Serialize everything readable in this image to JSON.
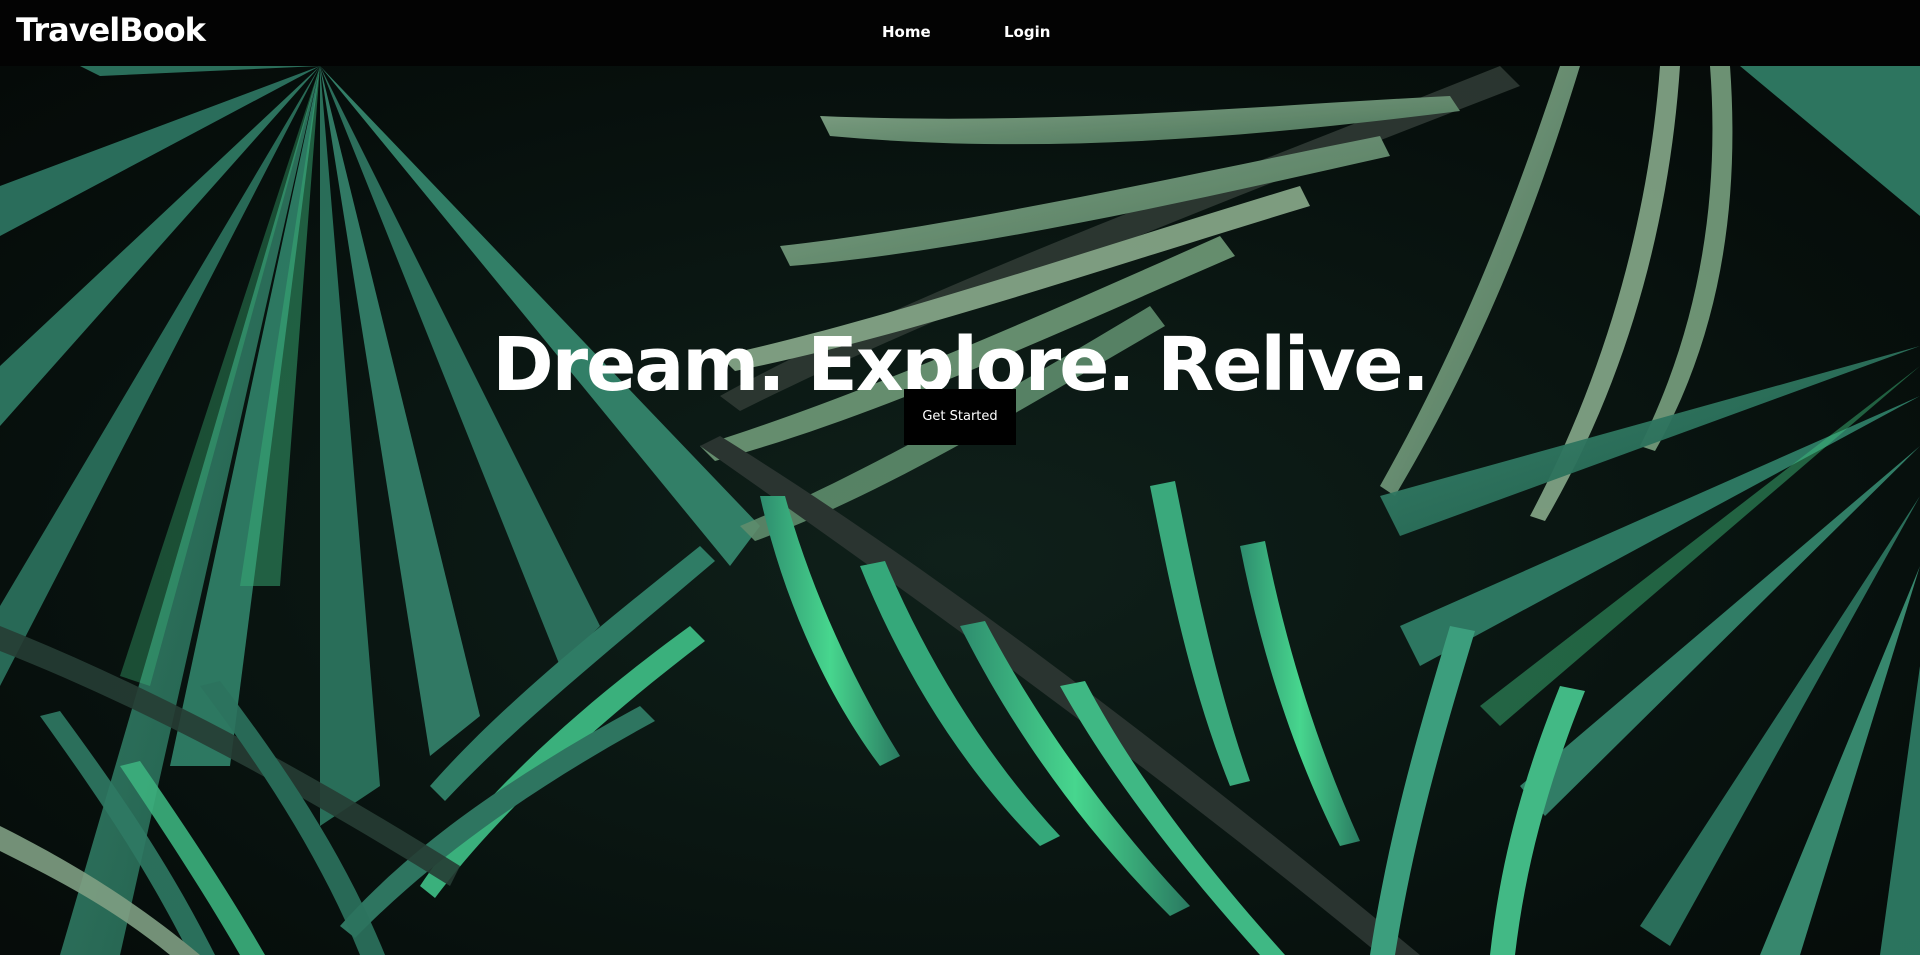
{
  "brand": {
    "name": "TravelBook"
  },
  "nav": {
    "items": [
      {
        "label": "Home"
      },
      {
        "label": "Login"
      }
    ]
  },
  "hero": {
    "headline": "Dream. Explore. Relive.",
    "cta_label": "Get Started",
    "background": "tropical-palm-leaves-image"
  },
  "colors": {
    "navbar_bg": "#030303",
    "text": "#ffffff",
    "cta_bg": "#000000",
    "leaf_dark": "#2f7a62",
    "leaf_light": "#7fa684",
    "leaf_bright": "#3fcf86"
  }
}
